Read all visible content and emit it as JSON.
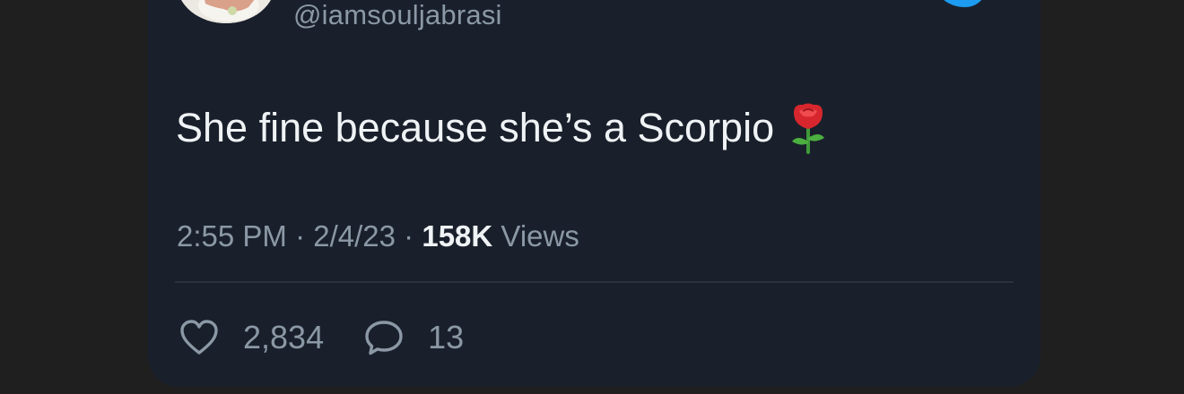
{
  "tweet": {
    "handle": "@iamsouljabrasi",
    "text": "She fine because she’s a Scorpio",
    "emoji": "rose",
    "time": "2:55 PM",
    "separator": "·",
    "date": "2/4/23",
    "views_count": "158K",
    "views_label": "Views",
    "likes_count": "2,834",
    "replies_count": "13"
  },
  "icons": {
    "brand": "twitter-bird-icon",
    "like": "heart-icon",
    "reply": "reply-bubble-icon"
  },
  "colors": {
    "background": "#1f1f1f",
    "card": "#19202b",
    "text": "#f0f3f5",
    "muted": "#8b98a5",
    "brand_blue": "#1d9bf0"
  }
}
